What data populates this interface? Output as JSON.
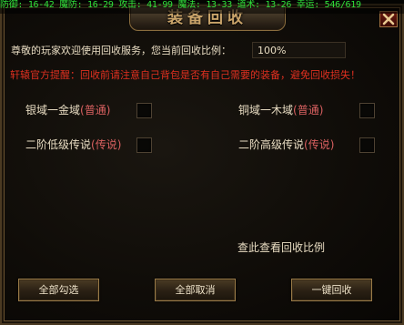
{
  "stats_bar": "防御: 16-42 魔防: 16-29 攻击: 41-99 魔法: 13-33 道术: 13-26 幸运: 546/619",
  "window": {
    "title": "装备回收",
    "close_icon": "close-icon"
  },
  "recycle_rate": {
    "label": "尊敬的玩家欢迎使用回收服务，您当前回收比例：",
    "value": "100%"
  },
  "warning_text": "轩辕官方提醒：回收前请注意自己背包是否有自己需要的装备，避免回收损失！",
  "options": [
    {
      "name": "银域一金域",
      "tag": "(普通)",
      "checked": false
    },
    {
      "name": "铜域一木域",
      "tag": "(普通)",
      "checked": false
    },
    {
      "name": "二阶低级传说",
      "tag": "(传说)",
      "checked": false
    },
    {
      "name": "二阶高级传说",
      "tag": "(传说)",
      "checked": false
    }
  ],
  "view_ratio_link": "查此查看回收比例",
  "buttons": {
    "select_all": "全部勾选",
    "cancel_all": "全部取消",
    "one_click_recycle": "一键回收"
  },
  "colors": {
    "stats_text": "#2fe03a",
    "warning": "#e03020",
    "tag": "#d86060",
    "border_gold": "#9a7b48"
  }
}
